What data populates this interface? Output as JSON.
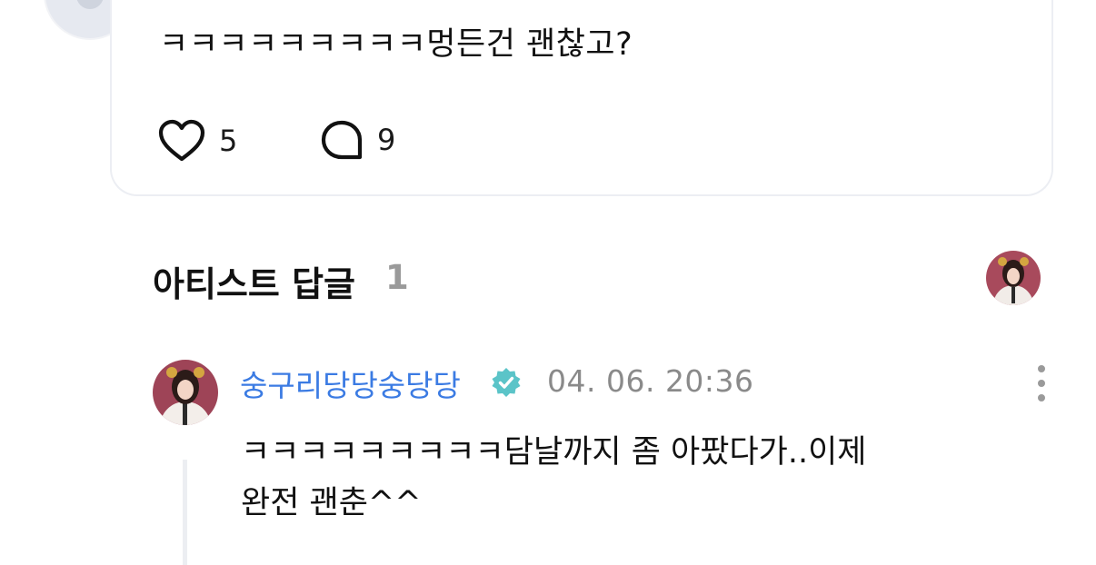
{
  "post": {
    "text": "ㅋㅋㅋㅋㅋㅋㅋㅋㅋ멍든건 괜찮고?",
    "like_count": "5",
    "comment_count": "9"
  },
  "artist_replies": {
    "title": "아티스트 답글",
    "count": "1"
  },
  "reply": {
    "author": "숭구리당당숭당당",
    "timestamp": "04. 06. 20:36",
    "line1": "ㅋㅋㅋㅋㅋㅋㅋㅋㅋ담날까지 좀 아팠다가..이제",
    "line2": "완전 괜춘^^"
  },
  "colors": {
    "accent_blue": "#3b7be3",
    "verified_teal": "#5bc4c8",
    "muted_gray": "#8a8a8a"
  }
}
